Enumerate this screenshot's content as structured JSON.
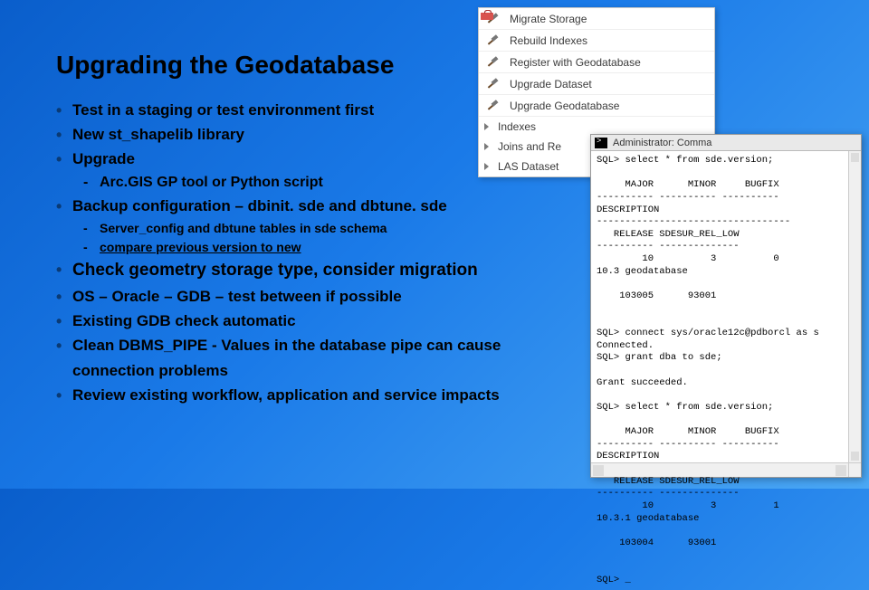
{
  "title": "Upgrading the Geodatabase",
  "bullets": {
    "b1": "Test in a staging or test environment first",
    "b2": "New st_shapelib library",
    "b3": "Upgrade",
    "b3s1": "Arc.GIS GP tool or Python script",
    "b4": "Backup configuration – dbinit. sde and dbtune. sde",
    "b4s1": "Server_config and dbtune tables in sde schema",
    "b4s2": "compare previous version to new",
    "b5": "Check geometry storage type, consider migration",
    "b6": "OS – Oracle – GDB – test between if possible",
    "b7": "Existing GDB check automatic",
    "b8": "Clean DBMS_PIPE - Values in the database pipe can cause connection problems",
    "b9": "Review existing workflow, application and service impacts"
  },
  "context_menu": {
    "items": [
      "Migrate Storage",
      "Rebuild Indexes",
      "Register with Geodatabase",
      "Upgrade Dataset",
      "Upgrade Geodatabase"
    ],
    "tree": [
      "Indexes",
      "Joins and Re",
      "LAS Dataset"
    ]
  },
  "terminal": {
    "title": "Administrator: Comma",
    "body": "SQL> select * from sde.version;\n\n     MAJOR      MINOR     BUGFIX\n---------- ---------- ----------\nDESCRIPTION\n----------------------------------\n   RELEASE SDESUR_REL_LOW\n---------- --------------\n        10          3          0\n10.3 geodatabase\n\n    103005      93001\n\n\nSQL> connect sys/oracle12c@pdborcl as s\nConnected.\nSQL> grant dba to sde;\n\nGrant succeeded.\n\nSQL> select * from sde.version;\n\n     MAJOR      MINOR     BUGFIX\n---------- ---------- ----------\nDESCRIPTION\n----------------------------------\n   RELEASE SDESUR_REL_LOW\n---------- --------------\n        10          3          1\n10.3.1 geodatabase\n\n    103004      93001\n\n\nSQL> _"
  }
}
